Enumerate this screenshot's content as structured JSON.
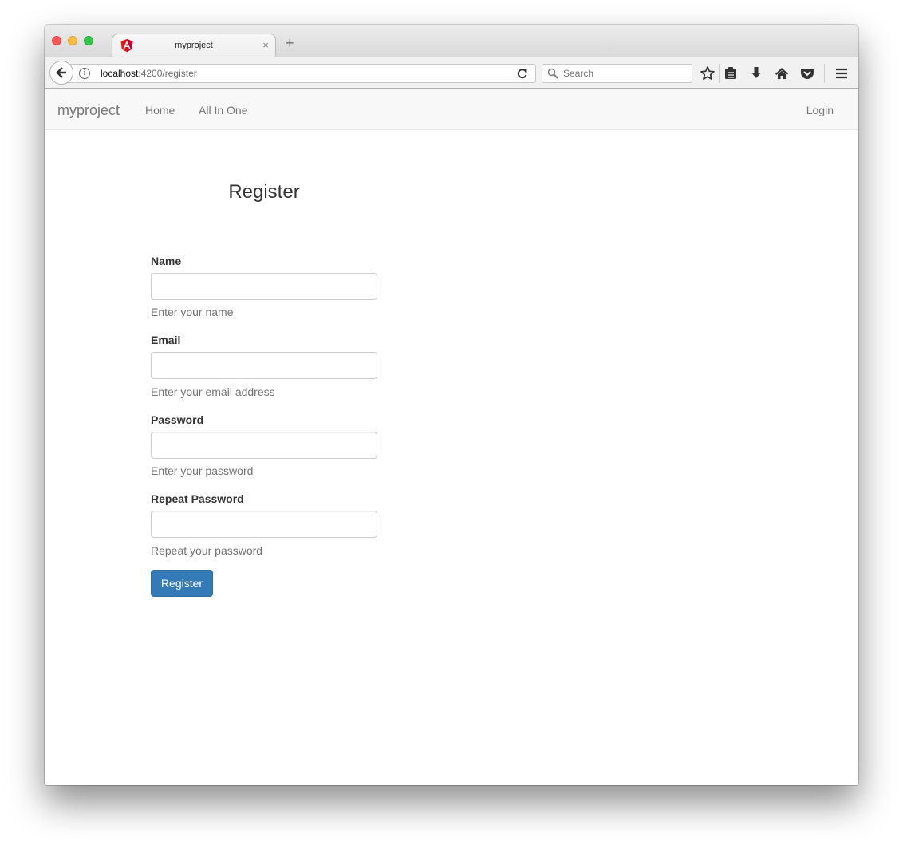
{
  "browser": {
    "tab": {
      "title": "myproject",
      "favicon": "angular-icon",
      "close_glyph": "×"
    },
    "new_tab_glyph": "+",
    "url": {
      "host": "localhost",
      "path": ":4200/register"
    },
    "search": {
      "placeholder": "Search",
      "value": ""
    },
    "toolbar_icons": [
      "bookmark-star-icon",
      "reading-list-icon",
      "downloads-icon",
      "home-icon",
      "pocket-icon",
      "menu-icon"
    ]
  },
  "navbar": {
    "brand": "myproject",
    "links": [
      {
        "label": "Home"
      },
      {
        "label": "All In One"
      }
    ],
    "right_link": "Login"
  },
  "form": {
    "title": "Register",
    "fields": [
      {
        "label": "Name",
        "value": "",
        "help": "Enter your name"
      },
      {
        "label": "Email",
        "value": "",
        "help": "Enter your email address"
      },
      {
        "label": "Password",
        "value": "",
        "help": "Enter your password"
      },
      {
        "label": "Repeat Password",
        "value": "",
        "help": "Repeat your password"
      }
    ],
    "submit_label": "Register"
  },
  "colors": {
    "primary_button": "#337ab7",
    "navbar_bg": "#f8f8f8",
    "angular_red": "#dd1b16"
  }
}
